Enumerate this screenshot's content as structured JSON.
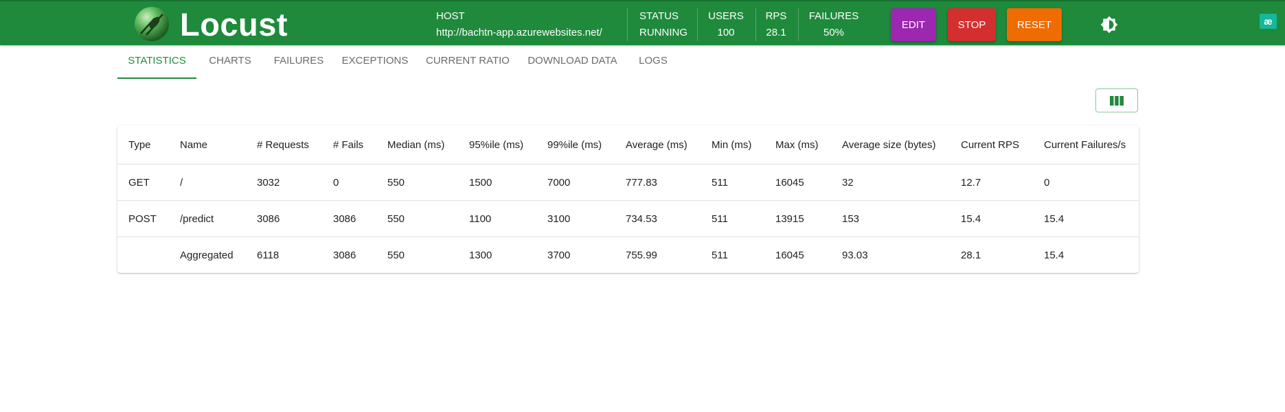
{
  "header": {
    "brand": "Locust",
    "host_label": "HOST",
    "host_value": "http://bachtn-app.azurewebsites.net/",
    "status_label": "STATUS",
    "status_value": "RUNNING",
    "users_label": "USERS",
    "users_value": "100",
    "rps_label": "RPS",
    "rps_value": "28.1",
    "failures_label": "FAILURES",
    "failures_value": "50%",
    "buttons": {
      "edit": "EDIT",
      "stop": "STOP",
      "reset": "RESET"
    },
    "corner_badge": "æ",
    "colors": {
      "appbar": "#1f8a3c",
      "edit": "#9c27b0",
      "stop": "#d32f2f",
      "reset": "#ef6c00"
    }
  },
  "tabs": [
    {
      "label": "STATISTICS",
      "active": true
    },
    {
      "label": "CHARTS"
    },
    {
      "label": "FAILURES"
    },
    {
      "label": "EXCEPTIONS"
    },
    {
      "label": "CURRENT RATIO"
    },
    {
      "label": "DOWNLOAD DATA"
    },
    {
      "label": "LOGS"
    }
  ],
  "table": {
    "columns": [
      "Type",
      "Name",
      "# Requests",
      "# Fails",
      "Median (ms)",
      "95%ile (ms)",
      "99%ile (ms)",
      "Average (ms)",
      "Min (ms)",
      "Max (ms)",
      "Average size (bytes)",
      "Current RPS",
      "Current Failures/s"
    ],
    "rows": [
      [
        "GET",
        "/",
        "3032",
        "0",
        "550",
        "1500",
        "7000",
        "777.83",
        "511",
        "16045",
        "32",
        "12.7",
        "0"
      ],
      [
        "POST",
        "/predict",
        "3086",
        "3086",
        "550",
        "1100",
        "3100",
        "734.53",
        "511",
        "13915",
        "153",
        "15.4",
        "15.4"
      ],
      [
        "",
        "Aggregated",
        "6118",
        "3086",
        "550",
        "1300",
        "3700",
        "755.99",
        "511",
        "16045",
        "93.03",
        "28.1",
        "15.4"
      ]
    ]
  }
}
